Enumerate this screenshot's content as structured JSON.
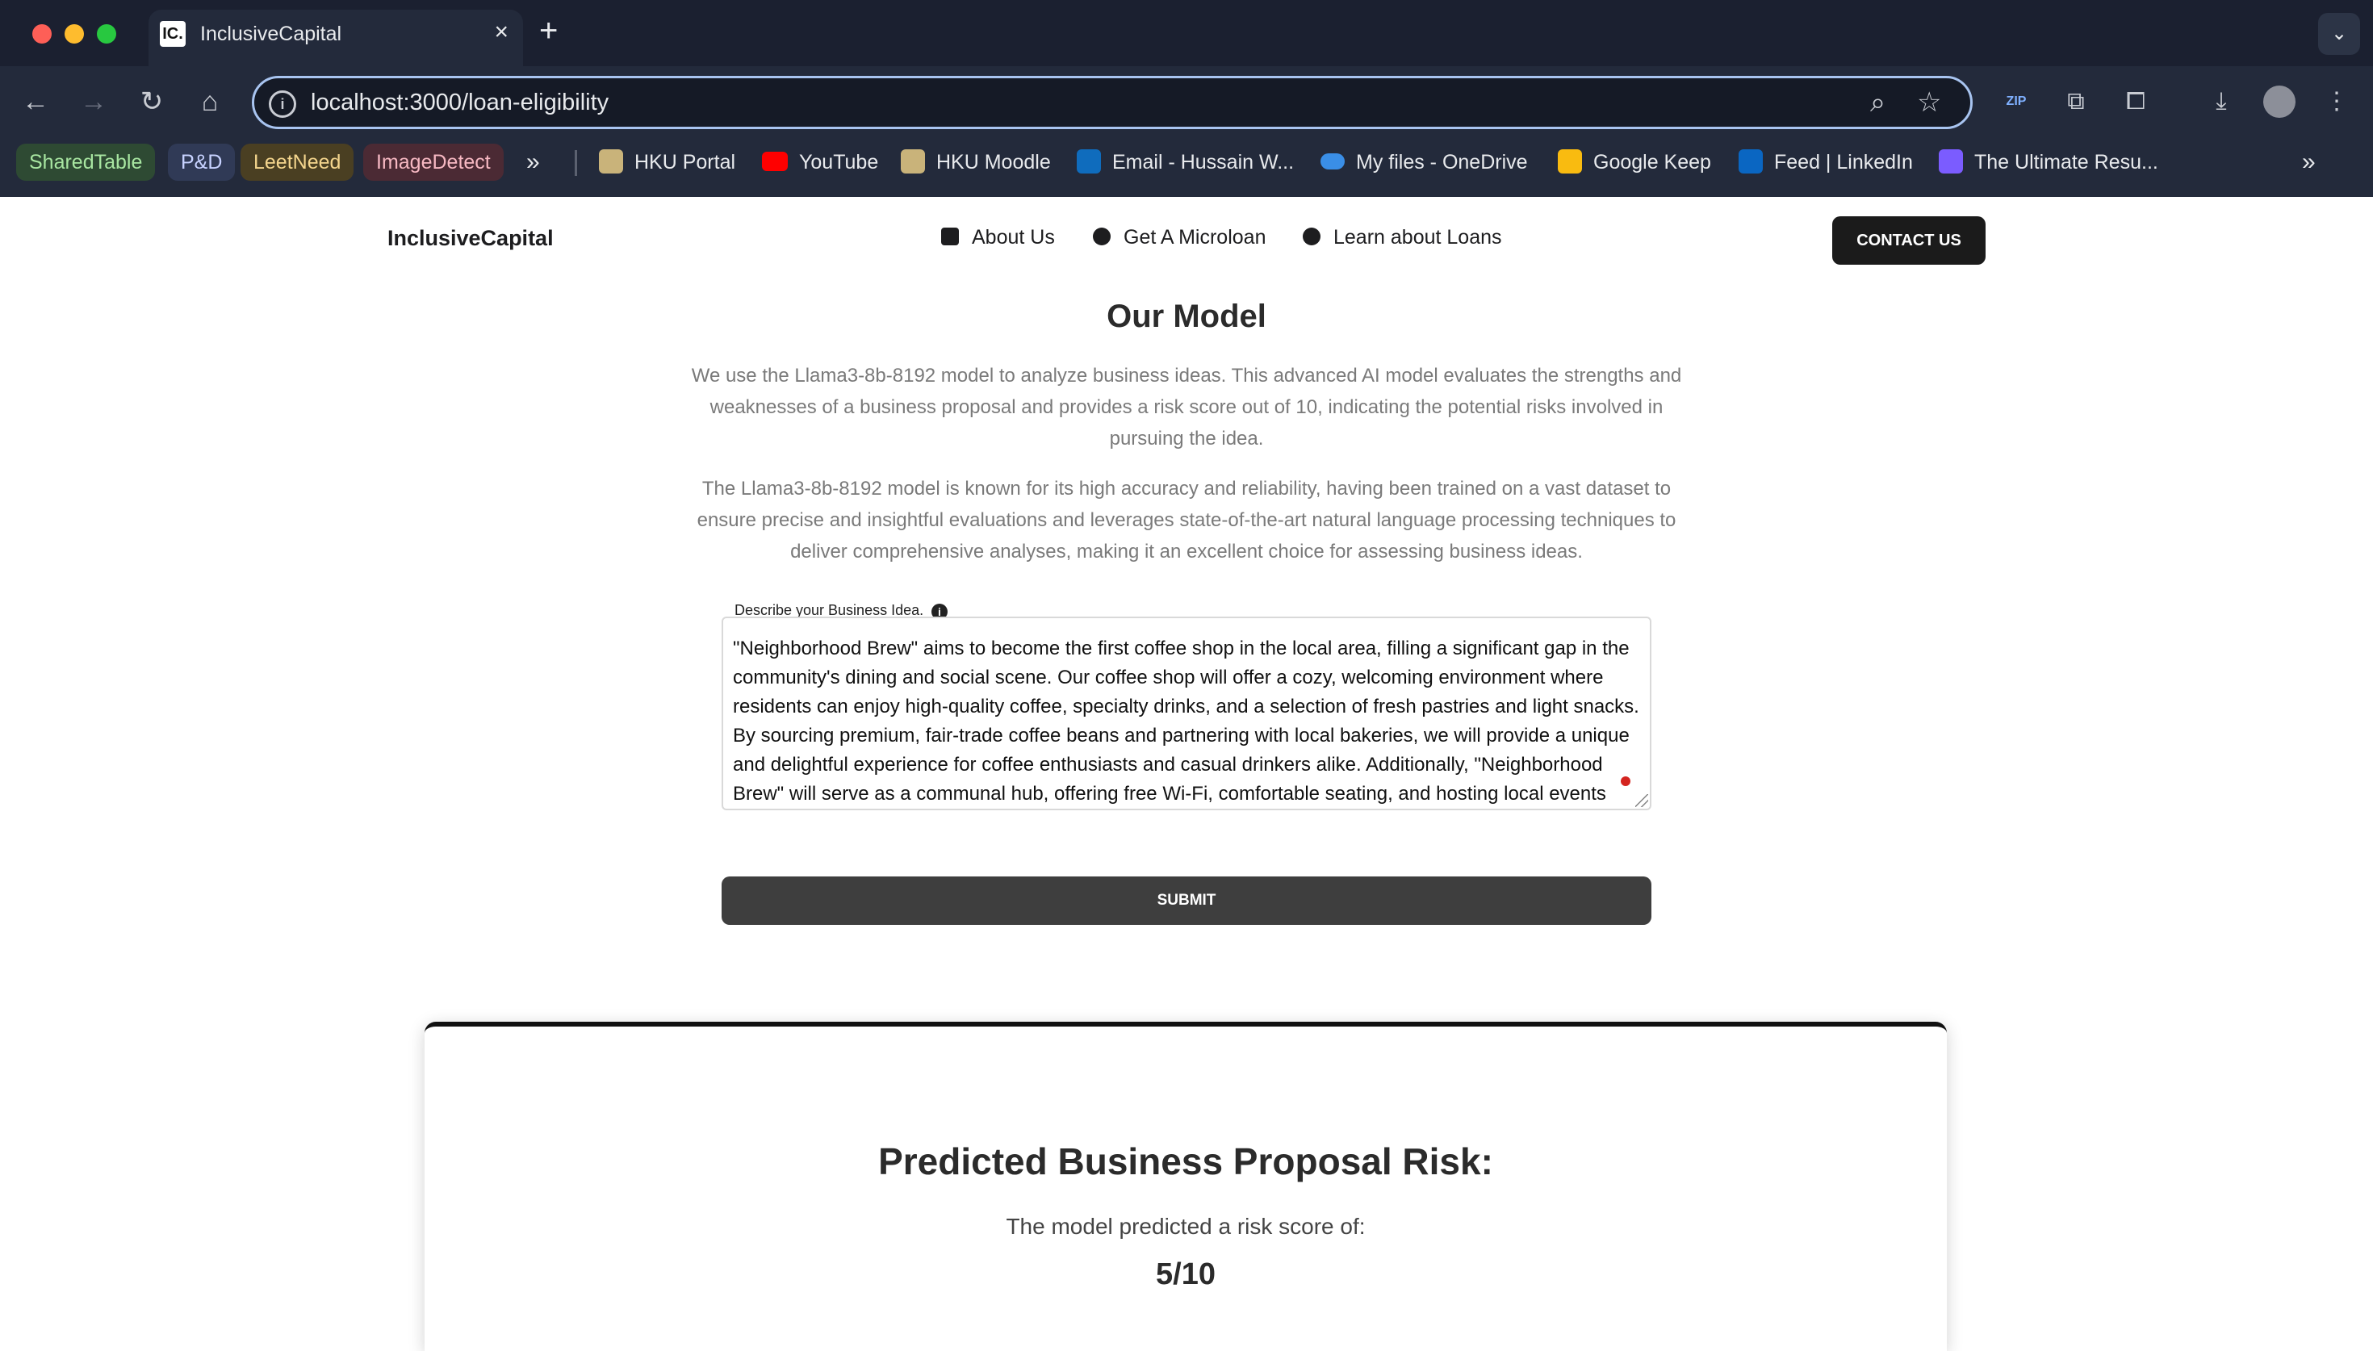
{
  "browser": {
    "tab_title": "InclusiveCapital",
    "tab_favicon_text": "IC.",
    "url": "localhost:3000/loan-eligibility",
    "bookmarks": [
      {
        "label": "SharedTable",
        "color": "#a8e6a1",
        "bg": "#2e4a33"
      },
      {
        "label": "P&D",
        "color": "#c7d2ff",
        "bg": "#303a56"
      },
      {
        "label": "LeetNeed",
        "color": "#f4d58d",
        "bg": "#4a3f22"
      },
      {
        "label": "ImageDetect",
        "color": "#f6b8c2",
        "bg": "#4b2a34"
      },
      {
        "label": "HKU Portal",
        "icon": "hku-icon"
      },
      {
        "label": "YouTube",
        "icon": "youtube-icon"
      },
      {
        "label": "HKU Moodle",
        "icon": "hku-icon"
      },
      {
        "label": "Email - Hussain W...",
        "icon": "outlook-icon"
      },
      {
        "label": "My files - OneDrive",
        "icon": "onedrive-icon"
      },
      {
        "label": "Google Keep",
        "icon": "keep-icon"
      },
      {
        "label": "Feed | LinkedIn",
        "icon": "linkedin-icon"
      },
      {
        "label": "The Ultimate Resu...",
        "icon": "resume-icon"
      }
    ]
  },
  "header": {
    "logo": "InclusiveCapital",
    "nav": [
      "About Us",
      "Get A Microloan",
      "Learn about Loans"
    ],
    "contact_label": "CONTACT US"
  },
  "model": {
    "title": "Our Model",
    "paragraph1": "We use the Llama3-8b-8192 model to analyze business ideas. This advanced AI model evaluates the strengths and weaknesses of a business proposal and provides a risk score out of 10, indicating the potential risks involved in pursuing the idea.",
    "paragraph2": "The Llama3-8b-8192 model is known for its high accuracy and reliability, having been trained on a vast dataset to ensure precise and insightful evaluations and leverages state-of-the-art natural language processing techniques to deliver comprehensive analyses, making it an excellent choice for assessing business ideas."
  },
  "form": {
    "label": "Describe your Business Idea.",
    "value": "\"Neighborhood Brew\" aims to become the first coffee shop in the local area, filling a significant gap in the community's dining and social scene. Our coffee shop will offer a cozy, welcoming environment where residents can enjoy high-quality coffee, specialty drinks, and a selection of fresh pastries and light snacks. By sourcing premium, fair-trade coffee beans and partnering with local bakeries, we will provide a unique and delightful experience for coffee enthusiasts and casual drinkers alike. Additionally, \"Neighborhood Brew\" will serve as a communal hub, offering free Wi-Fi, comfortable seating, and hosting local events",
    "submit_label": "SUBMIT"
  },
  "result": {
    "title": "Predicted Business Proposal Risk:",
    "subtitle": "The model predicted a risk score of:",
    "score": "5/10"
  }
}
